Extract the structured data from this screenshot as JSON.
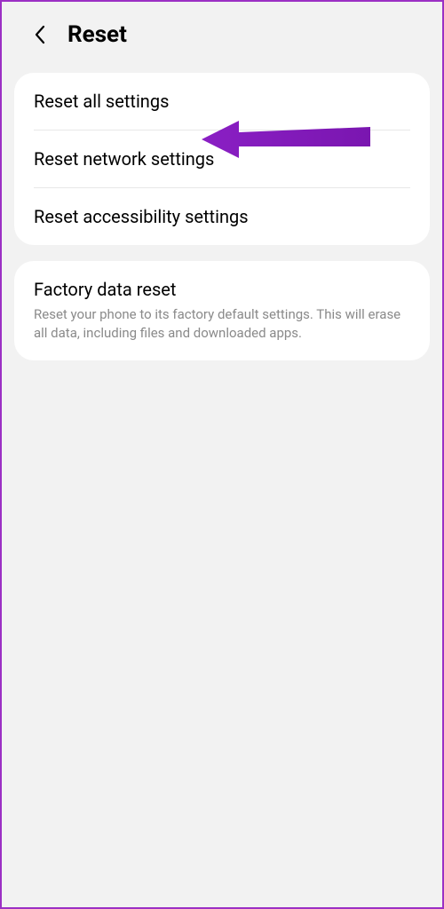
{
  "header": {
    "title": "Reset"
  },
  "group1": {
    "items": [
      {
        "title": "Reset all settings"
      },
      {
        "title": "Reset network settings"
      },
      {
        "title": "Reset accessibility settings"
      }
    ]
  },
  "group2": {
    "items": [
      {
        "title": "Factory data reset",
        "subtitle": "Reset your phone to its factory default settings. This will erase all data, including files and downloaded apps."
      }
    ]
  },
  "annotation": {
    "arrow_color": "#8a1fc4"
  }
}
